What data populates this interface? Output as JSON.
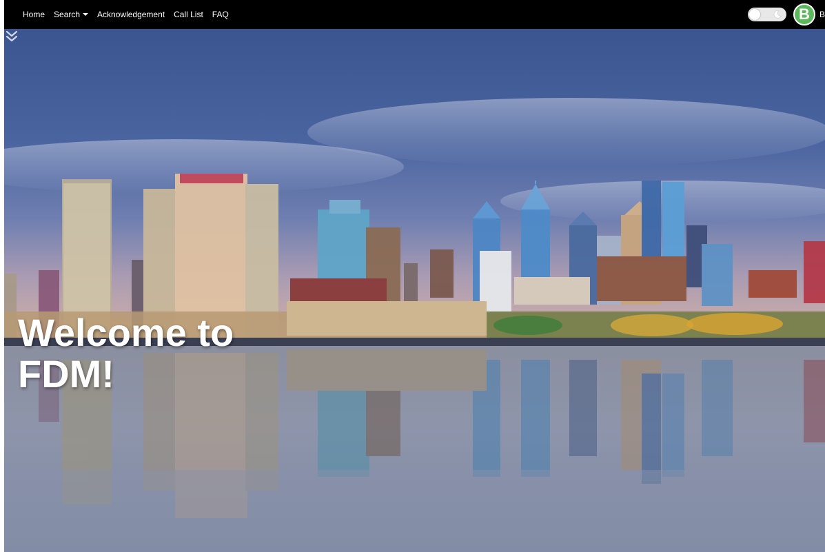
{
  "nav": {
    "items": [
      {
        "label": "Home",
        "dropdown": false
      },
      {
        "label": "Search",
        "dropdown": true
      },
      {
        "label": "Acknowledgement",
        "dropdown": false
      },
      {
        "label": "Call List",
        "dropdown": false
      },
      {
        "label": "FAQ",
        "dropdown": false
      }
    ],
    "theme_toggle_icon": "moon-icon",
    "avatar_initial": "B",
    "user_name": "B"
  },
  "hero": {
    "heading": "Welcome to FDM!",
    "background": "city-skyline-reflection-photo",
    "scroll_icon": "chevron-double-down-icon"
  },
  "colors": {
    "navbar": "#000000",
    "avatar": "#5cb85c",
    "sky_top": "#3e5a92",
    "water": "#8a93a8"
  }
}
